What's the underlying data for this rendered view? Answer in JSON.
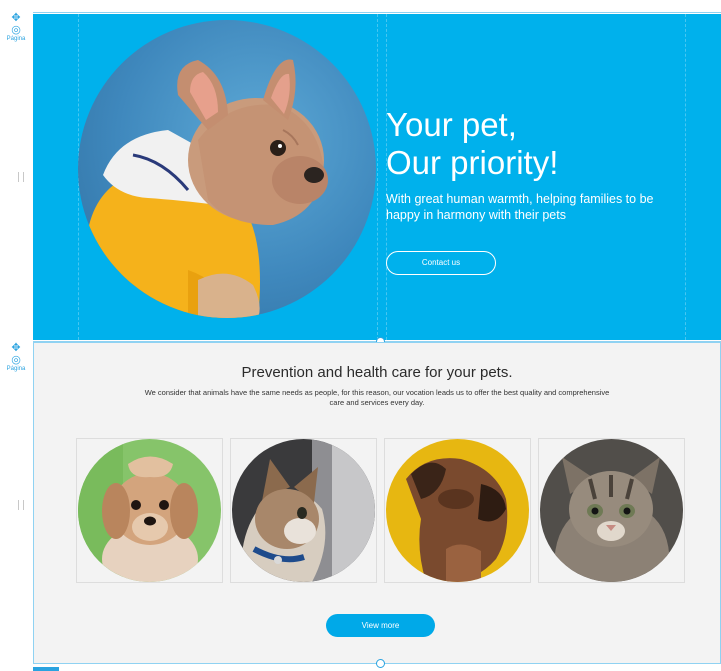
{
  "editor": {
    "page_tool_label": "Página",
    "colors": {
      "accent": "#00b1ec",
      "guide": "#8fd2f2"
    }
  },
  "hero": {
    "title_line1": "Your pet,",
    "title_line2": "Our priority!",
    "subtitle": "With great human warmth, helping families to be happy in harmony with their pets",
    "contact_label": "Contact us",
    "background": "#00b1ec",
    "image": "french-bulldog-in-yellow-hoodie"
  },
  "prevention": {
    "title": "Prevention and health care for your pets.",
    "description": "We consider that animals have the same needs as people, for this reason, our vocation leads us to offer the best quality and comprehensive care and services every day.",
    "cards": [
      {
        "image": "small-dog-on-green"
      },
      {
        "image": "cat-with-blue-collar"
      },
      {
        "image": "boxer-dog-on-yellow"
      },
      {
        "image": "tabby-kitten"
      }
    ],
    "view_more_label": "View more"
  }
}
